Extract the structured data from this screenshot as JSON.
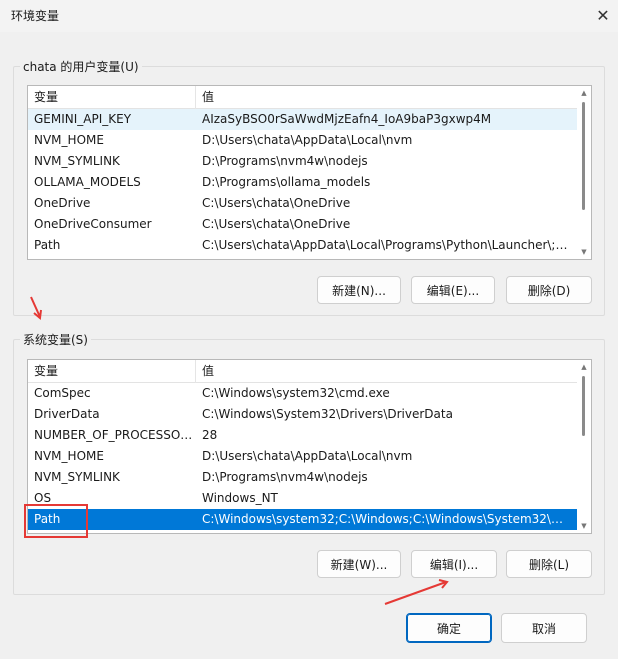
{
  "window": {
    "title": "环境变量"
  },
  "user_section": {
    "title": "chata 的用户变量(U)",
    "columns": {
      "name": "变量",
      "value": "值"
    },
    "rows": [
      {
        "name": "GEMINI_API_KEY",
        "value": "AIzaSyBSO0rSaWwdMjzEafn4_IoA9baP3gxwp4M"
      },
      {
        "name": "NVM_HOME",
        "value": "D:\\Users\\chata\\AppData\\Local\\nvm"
      },
      {
        "name": "NVM_SYMLINK",
        "value": "D:\\Programs\\nvm4w\\nodejs"
      },
      {
        "name": "OLLAMA_MODELS",
        "value": "D:\\Programs\\ollama_models"
      },
      {
        "name": "OneDrive",
        "value": "C:\\Users\\chata\\OneDrive"
      },
      {
        "name": "OneDriveConsumer",
        "value": "C:\\Users\\chata\\OneDrive"
      },
      {
        "name": "Path",
        "value": "C:\\Users\\chata\\AppData\\Local\\Programs\\Python\\Launcher\\;C..."
      }
    ],
    "buttons": {
      "new": "新建(N)...",
      "edit": "编辑(E)...",
      "delete": "删除(D)"
    }
  },
  "system_section": {
    "title": "系统变量(S)",
    "columns": {
      "name": "变量",
      "value": "值"
    },
    "rows": [
      {
        "name": "ComSpec",
        "value": "C:\\Windows\\system32\\cmd.exe"
      },
      {
        "name": "DriverData",
        "value": "C:\\Windows\\System32\\Drivers\\DriverData"
      },
      {
        "name": "NUMBER_OF_PROCESSORS",
        "value": "28"
      },
      {
        "name": "NVM_HOME",
        "value": "D:\\Users\\chata\\AppData\\Local\\nvm"
      },
      {
        "name": "NVM_SYMLINK",
        "value": "D:\\Programs\\nvm4w\\nodejs"
      },
      {
        "name": "OS",
        "value": "Windows_NT"
      },
      {
        "name": "Path",
        "value": "C:\\Windows\\system32;C:\\Windows;C:\\Windows\\System32\\Wb..."
      }
    ],
    "buttons": {
      "new": "新建(W)...",
      "edit": "编辑(I)...",
      "delete": "删除(L)"
    }
  },
  "footer": {
    "ok": "确定",
    "cancel": "取消"
  },
  "colors": {
    "selection": "#0078d7",
    "annotation": "#e53935",
    "hover": "#e5f3fb"
  }
}
